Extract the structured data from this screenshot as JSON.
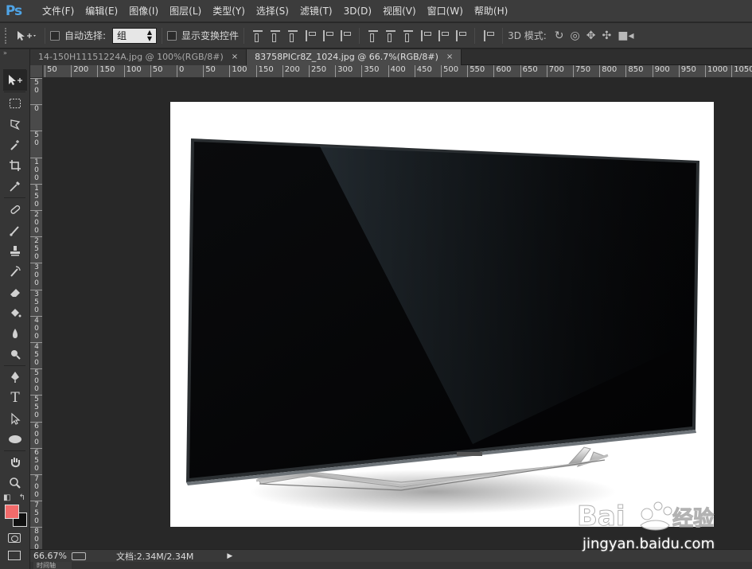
{
  "app": {
    "logo": "Ps"
  },
  "menu": [
    "文件(F)",
    "编辑(E)",
    "图像(I)",
    "图层(L)",
    "类型(Y)",
    "选择(S)",
    "滤镜(T)",
    "3D(D)",
    "视图(V)",
    "窗口(W)",
    "帮助(H)"
  ],
  "options": {
    "auto_select_label": "自动选择:",
    "auto_select_value": "组",
    "show_transform_label": "显示变换控件",
    "three_d_mode_label": "3D 模式:"
  },
  "tabs": [
    {
      "label": "14-150H11151224A.jpg @ 100%(RGB/8#)",
      "close": "×",
      "active": false
    },
    {
      "label": "83758PICr8Z_1024.jpg @ 66.7%(RGB/8#)",
      "close": "×",
      "active": true
    }
  ],
  "ruler": {
    "h_ticks": [
      "50",
      "200",
      "150",
      "100",
      "50",
      "0",
      "50",
      "100",
      "150",
      "200",
      "250",
      "300",
      "350",
      "400",
      "450",
      "500",
      "550",
      "600",
      "650",
      "700",
      "750",
      "800",
      "850",
      "900",
      "950",
      "1000",
      "1050"
    ],
    "v_ticks": [
      "5\n0",
      "0",
      "5\n0",
      "1\n0\n0",
      "1\n5\n0",
      "2\n0\n0",
      "2\n5\n0",
      "3\n0\n0",
      "3\n5\n0",
      "4\n0\n0",
      "4\n5\n0",
      "5\n0\n0",
      "5\n5\n0",
      "6\n0\n0",
      "6\n5\n0",
      "7\n0\n0",
      "7\n5\n0",
      "8\n0\n0"
    ]
  },
  "status": {
    "zoom": "66.67%",
    "doc_size": "文档:2.34M/2.34M",
    "bottom_tab": "时间轴"
  },
  "colors": {
    "foreground": "#f26b6b",
    "background": "#111111",
    "accent": "#4fa4e6"
  },
  "watermark": {
    "text": "jingyan.baidu.com",
    "logo": "Baidu 经验"
  }
}
